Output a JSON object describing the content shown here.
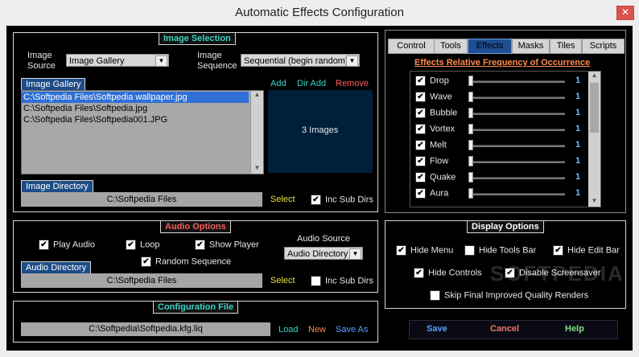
{
  "window": {
    "title": "Automatic Effects Configuration",
    "close": "✕"
  },
  "colors": {
    "teal": "#3bd3c3",
    "orange": "#ff8a4c",
    "red": "#ff5a5a",
    "green": "#7fe07f",
    "yellow": "#e8e23a",
    "blue": "#5aa0ff",
    "salmon": "#e87a6a"
  },
  "image_selection": {
    "title": "Image Selection",
    "image_source_label": "Image Source",
    "image_source_value": "Image Gallery",
    "image_sequence_label": "Image Sequence",
    "image_sequence_value": "Sequential (begin random)",
    "gallery_caption": "Image Gallery",
    "files": [
      "C:\\Softpedia Files\\Softpedia wallpaper.jpg",
      "C:\\Softpedia Files\\Softpedia.jpg",
      "C:\\Softpedia Files\\Softpedia001.JPG"
    ],
    "add": "Add",
    "dir_add": "Dir Add",
    "remove": "Remove",
    "count": "3 Images",
    "directory_caption": "Image Directory",
    "directory_value": "C:\\Softpedia Files",
    "select": "Select",
    "inc_sub_dirs": "Inc Sub Dirs"
  },
  "audio": {
    "title": "Audio Options",
    "play_audio": "Play Audio",
    "loop": "Loop",
    "show_player": "Show Player",
    "random_sequence": "Random Sequence",
    "source_label": "Audio Source",
    "source_value": "Audio Directory",
    "directory_caption": "Audio Directory",
    "directory_value": "C:\\Softpedia Files",
    "select": "Select",
    "inc_sub_dirs": "Inc Sub Dirs"
  },
  "config": {
    "title": "Configuration File",
    "path": "C:\\Softpedia\\Softpedia.kfg.liq",
    "load": "Load",
    "new": "New",
    "save_as": "Save As"
  },
  "tabs": [
    "Control",
    "Tools",
    "Effects",
    "Masks",
    "Tiles",
    "Scripts"
  ],
  "effects": {
    "header": "Effects Relative Frequency of Occurrence",
    "items": [
      {
        "name": "Drop",
        "value": "1"
      },
      {
        "name": "Wave",
        "value": "1"
      },
      {
        "name": "Bubble",
        "value": "1"
      },
      {
        "name": "Vortex",
        "value": "1"
      },
      {
        "name": "Melt",
        "value": "1"
      },
      {
        "name": "Flow",
        "value": "1"
      },
      {
        "name": "Quake",
        "value": "1"
      },
      {
        "name": "Aura",
        "value": "1"
      }
    ]
  },
  "display": {
    "title": "Display Options",
    "hide_menu": "Hide Menu",
    "hide_tools_bar": "Hide Tools Bar",
    "hide_edit_bar": "Hide Edit Bar",
    "hide_controls": "Hide Controls",
    "disable_screensaver": "Disable Screensaver",
    "skip_final": "Skip Final Improved Quality Renders"
  },
  "buttons": {
    "save": "Save",
    "cancel": "Cancel",
    "help": "Help"
  },
  "watermark": "SOFTPEDIA"
}
